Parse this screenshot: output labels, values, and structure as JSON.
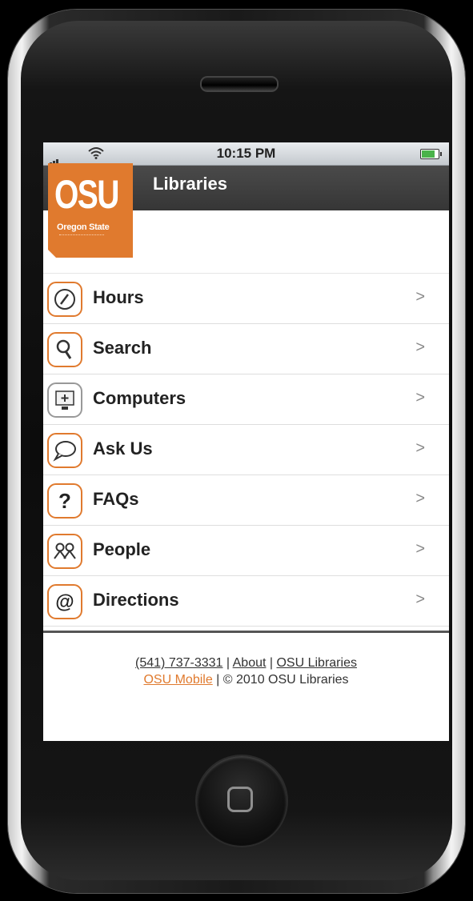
{
  "status_bar": {
    "time": "10:15 PM"
  },
  "header": {
    "title": "Libraries"
  },
  "logo": {
    "word": "OSU",
    "subtitle": "Oregon State"
  },
  "menu": [
    {
      "label": "Hours",
      "icon": "clock-icon",
      "chevron": ">"
    },
    {
      "label": "Search",
      "icon": "magnifier-icon",
      "chevron": ">"
    },
    {
      "label": "Computers",
      "icon": "computer-icon",
      "chevron": ">"
    },
    {
      "label": "Ask Us",
      "icon": "speech-bubble-icon",
      "chevron": ">"
    },
    {
      "label": "FAQs",
      "icon": "question-mark-icon",
      "chevron": ">"
    },
    {
      "label": "People",
      "icon": "people-icon",
      "chevron": ">"
    },
    {
      "label": "Directions",
      "icon": "at-sign-icon",
      "chevron": ">"
    }
  ],
  "footer": {
    "phone": "(541) 737-3331",
    "sep1": " | ",
    "about": "About",
    "sep2": " | ",
    "libraries": "OSU Libraries",
    "mobile": "OSU Mobile",
    "copyright": " | © 2010 OSU Libraries"
  },
  "colors": {
    "accent": "#e07a2e",
    "header": "#3d3d3d"
  }
}
